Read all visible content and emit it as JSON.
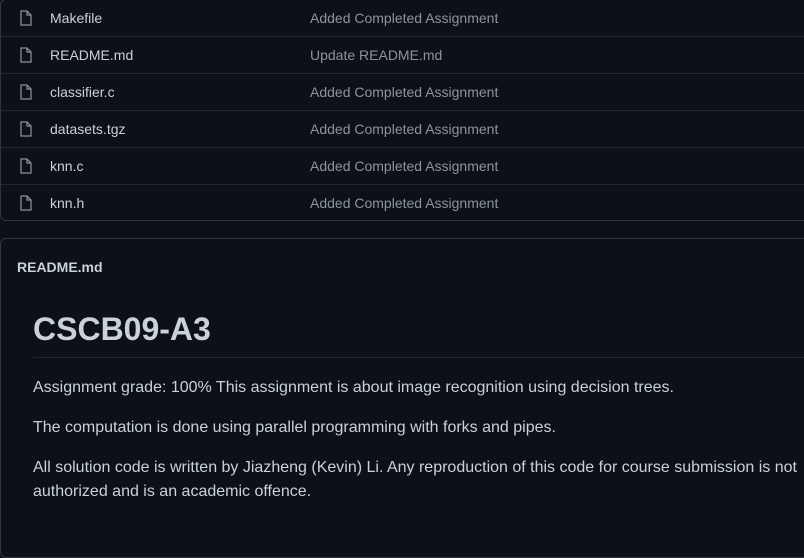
{
  "files": [
    {
      "name": "Makefile",
      "commit": "Added Completed Assignment",
      "icon": "file-icon"
    },
    {
      "name": "README.md",
      "commit": "Update README.md",
      "icon": "file-icon"
    },
    {
      "name": "classifier.c",
      "commit": "Added Completed Assignment",
      "icon": "file-icon"
    },
    {
      "name": "datasets.tgz",
      "commit": "Added Completed Assignment",
      "icon": "file-icon"
    },
    {
      "name": "knn.c",
      "commit": "Added Completed Assignment",
      "icon": "file-icon"
    },
    {
      "name": "knn.h",
      "commit": "Added Completed Assignment",
      "icon": "file-icon"
    }
  ],
  "readme": {
    "header": "README.md",
    "title": "CSCB09-A3",
    "paragraphs": [
      "Assignment grade: 100% This assignment is about image recognition using decision trees.",
      "The computation is done using parallel programming with forks and pipes.",
      "All solution code is written by Jiazheng (Kevin) Li. Any reproduction of this code for course submission is not authorized and is an academic offence."
    ]
  },
  "colors": {
    "background": "#0d1117",
    "border": "#30363d",
    "text": "#c9d1d9",
    "muted": "#8b949e"
  }
}
